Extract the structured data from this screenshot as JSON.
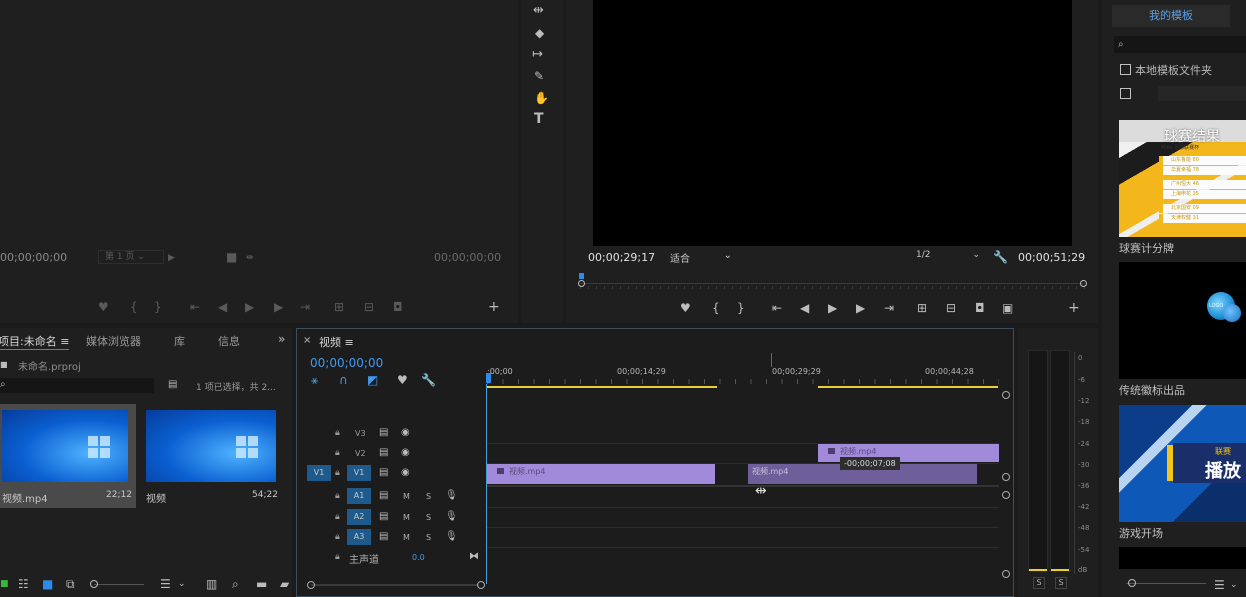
{
  "source_monitor": {
    "tc_left": "00;00;00;00",
    "page_select": "第 1 页",
    "tc_right": "00;00;00;00"
  },
  "tools": {
    "icons": [
      "ripple-edit-icon",
      "razor-icon",
      "slip-icon",
      "pen-icon",
      "hand-icon",
      "type-icon"
    ]
  },
  "program_monitor": {
    "tc_current": "00;00;29;17",
    "fit": "适合",
    "resolution": "1/2",
    "tc_duration": "00;00;51;29"
  },
  "templates": {
    "tab": "我的模板",
    "local_folder": "本地模板文件夹",
    "items": [
      {
        "name": "球赛计分牌",
        "thumb_title": "球赛结果",
        "thumb_sub": "Mike 足球联赛杯",
        "rows": [
          "山东鲁能 80",
          "华夏幸福 78",
          "广州恒大 46",
          "上海申花 35",
          "北京国安 09",
          "天津权健 31"
        ]
      },
      {
        "name": "传统徽标出品",
        "thumb_title": "LOGO"
      },
      {
        "name": "游戏开场",
        "thumb_title": "播放",
        "thumb_badge": "联赛"
      }
    ]
  },
  "project": {
    "tabs": [
      "项目:未命名",
      "媒体浏览器",
      "库",
      "信息"
    ],
    "file": "未命名.prproj",
    "selection": "1 项已选择，共 2...",
    "items": [
      {
        "name": "视频.mp4",
        "duration": "22;12"
      },
      {
        "name": "视频",
        "duration": "54;22"
      }
    ]
  },
  "timeline": {
    "tab": "视频",
    "timecode": "00;00;00;00",
    "ruler": [
      ";00;00",
      "00;00;14;29",
      "00;00;29;29",
      "00;00;44;28"
    ],
    "video_tracks": [
      "V3",
      "V2",
      "V1"
    ],
    "audio_tracks": [
      "A1",
      "A2",
      "A3"
    ],
    "source_patch": "V1",
    "master": "主声道",
    "master_value": "0.0",
    "m_label": "M",
    "s_label": "S",
    "clips": {
      "v2": "视频.mp4",
      "v1a": "视频.mp4",
      "v1b": "视频.mp4"
    },
    "drag_offset": "-00;00;07;08"
  },
  "audio_meter": {
    "scale": [
      "0",
      "-6",
      "-12",
      "-18",
      "-24",
      "-30",
      "-36",
      "-42",
      "-48",
      "-54",
      "dB"
    ],
    "solo": [
      "S",
      "S"
    ]
  },
  "colors": {
    "accent": "#2d8ceb",
    "clip": "#a08ad9",
    "clip_dark": "#6e5e99",
    "work_area": "#e8cf3a"
  }
}
